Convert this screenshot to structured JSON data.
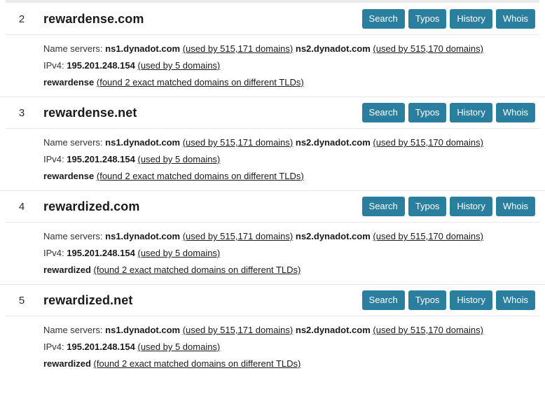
{
  "page": {
    "background": "#ffffff",
    "accent_color": "#2b7f9e",
    "separator_color": "#e6e6e6"
  },
  "actions": {
    "search_label": "Search",
    "typos_label": "Typos",
    "history_label": "History",
    "whois_label": "Whois"
  },
  "detail_labels": {
    "name_servers": "Name servers:",
    "ipv4": "IPv4:"
  },
  "results": [
    {
      "rank": "2",
      "sld": "rewardense",
      "tld": ".com",
      "ns1": "ns1.dynadot.com",
      "ns1_link": "(used by 515,171 domains)",
      "ns2": "ns2.dynadot.com",
      "ns2_link": "(used by 515,170 domains)",
      "ipv4": "195.201.248.154",
      "ipv4_link": "(used by 5 domains)",
      "keyword": "rewardense",
      "keyword_link": "(found 2 exact matched domains on different TLDs)"
    },
    {
      "rank": "3",
      "sld": "rewardense",
      "tld": ".net",
      "ns1": "ns1.dynadot.com",
      "ns1_link": "(used by 515,171 domains)",
      "ns2": "ns2.dynadot.com",
      "ns2_link": "(used by 515,170 domains)",
      "ipv4": "195.201.248.154",
      "ipv4_link": "(used by 5 domains)",
      "keyword": "rewardense",
      "keyword_link": "(found 2 exact matched domains on different TLDs)"
    },
    {
      "rank": "4",
      "sld": "rewardized",
      "tld": ".com",
      "ns1": "ns1.dynadot.com",
      "ns1_link": "(used by 515,171 domains)",
      "ns2": "ns2.dynadot.com",
      "ns2_link": "(used by 515,170 domains)",
      "ipv4": "195.201.248.154",
      "ipv4_link": "(used by 5 domains)",
      "keyword": "rewardized",
      "keyword_link": "(found 2 exact matched domains on different TLDs)"
    },
    {
      "rank": "5",
      "sld": "rewardized",
      "tld": ".net",
      "ns1": "ns1.dynadot.com",
      "ns1_link": "(used by 515,171 domains)",
      "ns2": "ns2.dynadot.com",
      "ns2_link": "(used by 515,170 domains)",
      "ipv4": "195.201.248.154",
      "ipv4_link": "(used by 5 domains)",
      "keyword": "rewardized",
      "keyword_link": "(found 2 exact matched domains on different TLDs)"
    }
  ]
}
